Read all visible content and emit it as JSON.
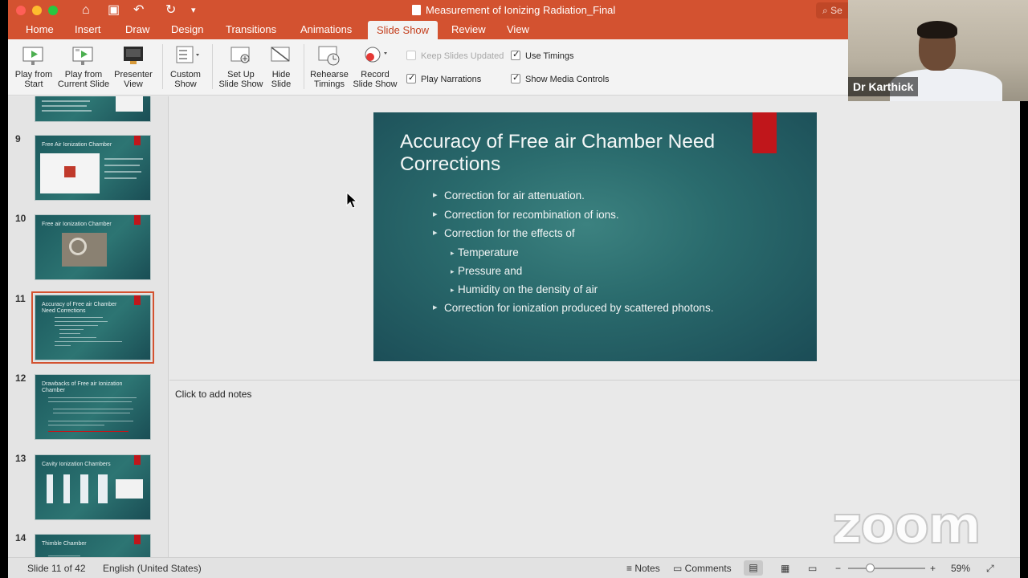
{
  "window": {
    "title": "Measurement of Ionizing Radiation_Final",
    "search_placeholder": "Se"
  },
  "tabs": [
    {
      "label": "Home"
    },
    {
      "label": "Insert"
    },
    {
      "label": "Draw"
    },
    {
      "label": "Design"
    },
    {
      "label": "Transitions"
    },
    {
      "label": "Animations"
    },
    {
      "label": "Slide Show",
      "active": true
    },
    {
      "label": "Review"
    },
    {
      "label": "View"
    }
  ],
  "ribbon": {
    "play_from_start": {
      "line1": "Play from",
      "line2": "Start"
    },
    "play_from_current": {
      "line1": "Play from",
      "line2": "Current Slide"
    },
    "presenter_view": {
      "line1": "Presenter",
      "line2": "View"
    },
    "custom_show": {
      "line1": "Custom",
      "line2": "Show"
    },
    "set_up": {
      "line1": "Set Up",
      "line2": "Slide Show"
    },
    "hide_slide": {
      "line1": "Hide",
      "line2": "Slide"
    },
    "rehearse": {
      "line1": "Rehearse",
      "line2": "Timings"
    },
    "record": {
      "line1": "Record",
      "line2": "Slide Show"
    },
    "checkboxes": {
      "keep_updated": {
        "label": "Keep Slides Updated",
        "checked": false,
        "enabled": false
      },
      "use_timings": {
        "label": "Use Timings",
        "checked": true
      },
      "play_narrations": {
        "label": "Play Narrations",
        "checked": true
      },
      "media_controls": {
        "label": "Show Media Controls",
        "checked": true
      }
    }
  },
  "thumbnails": [
    {
      "number": "9",
      "title": "Free Air Ionization Chamber"
    },
    {
      "number": "10",
      "title": "Free air Ionization Chamber"
    },
    {
      "number": "11",
      "title": "Accuracy of Free air Chamber Need Corrections",
      "selected": true
    },
    {
      "number": "12",
      "title": "Drawbacks of Free air Ionization Chamber"
    },
    {
      "number": "13",
      "title": "Cavity Ionization Chambers"
    },
    {
      "number": "14",
      "title": "Thimble Chamber"
    }
  ],
  "slide": {
    "title": "Accuracy of Free air Chamber Need Corrections",
    "bullets": {
      "b1": "Correction for air attenuation.",
      "b2": "Correction for recombination of ions.",
      "b3": "Correction for the effects of",
      "s1": "Temperature",
      "s2": "Pressure and",
      "s3": "Humidity on the density of air",
      "b4": "Correction for ionization produced by scattered photons."
    }
  },
  "notes": {
    "placeholder": "Click to add notes"
  },
  "status": {
    "slide_position": "Slide 11 of 42",
    "language": "English (United States)",
    "notes_label": "Notes",
    "comments_label": "Comments",
    "zoom": "59%"
  },
  "webcam": {
    "name": "Dr Karthick"
  },
  "watermark": "zoom"
}
